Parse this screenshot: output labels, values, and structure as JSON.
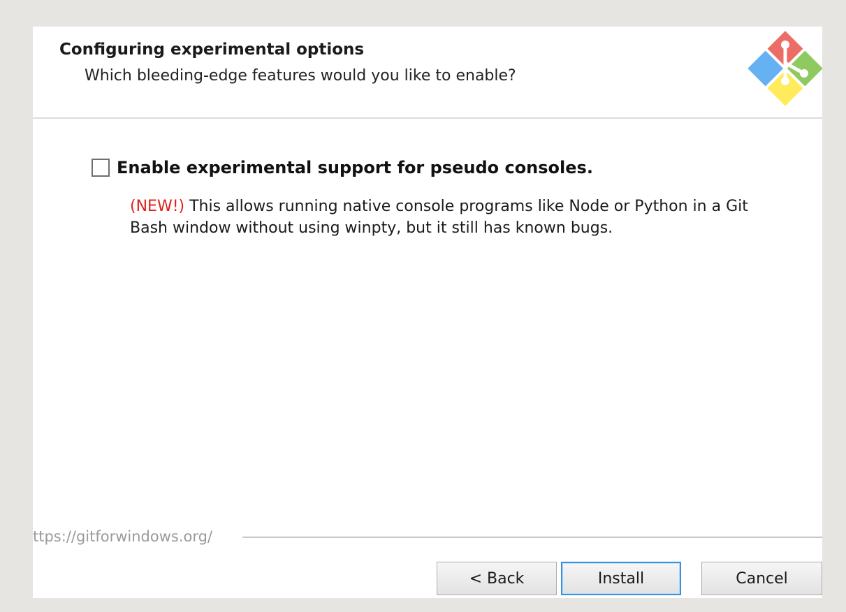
{
  "header": {
    "title": "Configuring experimental options",
    "subtitle": "Which bleeding-edge features would you like to enable?",
    "logo_icon": "git-logo-icon",
    "logo_colors": [
      "#e8534a",
      "#7ac143",
      "#ffe94a",
      "#4aa3f0"
    ]
  },
  "option": {
    "label": "Enable experimental support for pseudo consoles.",
    "checked": false,
    "new_tag": "(NEW!)",
    "description": " This allows running native console programs like Node or Python in a Git Bash window without using winpty, but it still has known bugs."
  },
  "footer": {
    "url": "ttps://gitforwindows.org/"
  },
  "buttons": {
    "back": "< Back",
    "install": "Install",
    "cancel": "Cancel"
  },
  "colors": {
    "new_tag": "#e0201b",
    "focus_border": "#3c8fdc"
  }
}
